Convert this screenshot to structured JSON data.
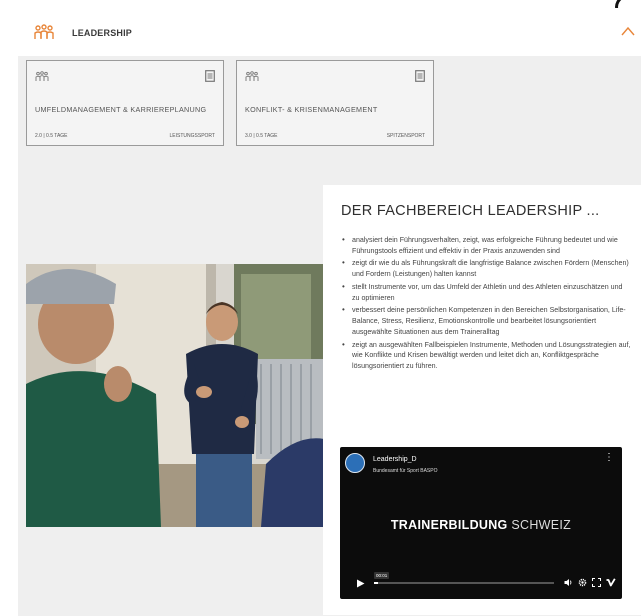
{
  "header": {
    "title": "LEADERSHIP",
    "accent_color": "#e8863a",
    "chevron_icon": "chevron-up-icon"
  },
  "cards": [
    {
      "title": "UMFELDMANAGEMENT & KARRIEREPLANUNG",
      "meta": "2.0 | 0.5 TAGE",
      "tag": "LEISTUNGSSPORT",
      "icon": "leadership-icon",
      "doc_icon": "document-icon"
    },
    {
      "title": "KONFLIKT- & KRISENMANAGEMENT",
      "meta": "3.0 | 0.5 TAGE",
      "tag": "SPITZENSPORT",
      "icon": "leadership-icon",
      "doc_icon": "document-icon"
    }
  ],
  "panel": {
    "heading": "DER FACHBEREICH LEADERSHIP ...",
    "bullets": [
      "analysiert dein Führungsverhalten, zeigt, was erfolgreiche Führung bedeutet und wie Führungstools effizient und effektiv in der Praxis anzuwenden sind",
      "zeigt dir wie du als Führungskraft die langfristige Balance zwischen Fördern (Menschen) und Fordern (Leistungen) halten kannst",
      "stellt Instrumente vor, um das Umfeld der Athletin und des Athleten einzuschätzen und zu optimieren",
      "verbessert deine persönlichen Kompetenzen in den Bereichen Selbstorganisation, Life-Balance, Stress, Resilienz, Emotionskontrolle und bearbeitet lösungsorientiert ausgewählte Situationen aus dem Traineralltag",
      "zeigt an ausgewählten Fallbeispielen Instrumente, Methoden und Lösungsstrategien auf, wie Konflikte und Krisen bewältigt werden und leitet dich an, Konfliktgespräche lösungsorientiert zu führen."
    ]
  },
  "video": {
    "title": "Leadership_D",
    "channel": "Bundesamt für Sport BASPO",
    "brand_bold": "TRAINERBILDUNG",
    "brand_light": "SCHWEIZ",
    "time": "00:01",
    "progress": 0.02
  }
}
